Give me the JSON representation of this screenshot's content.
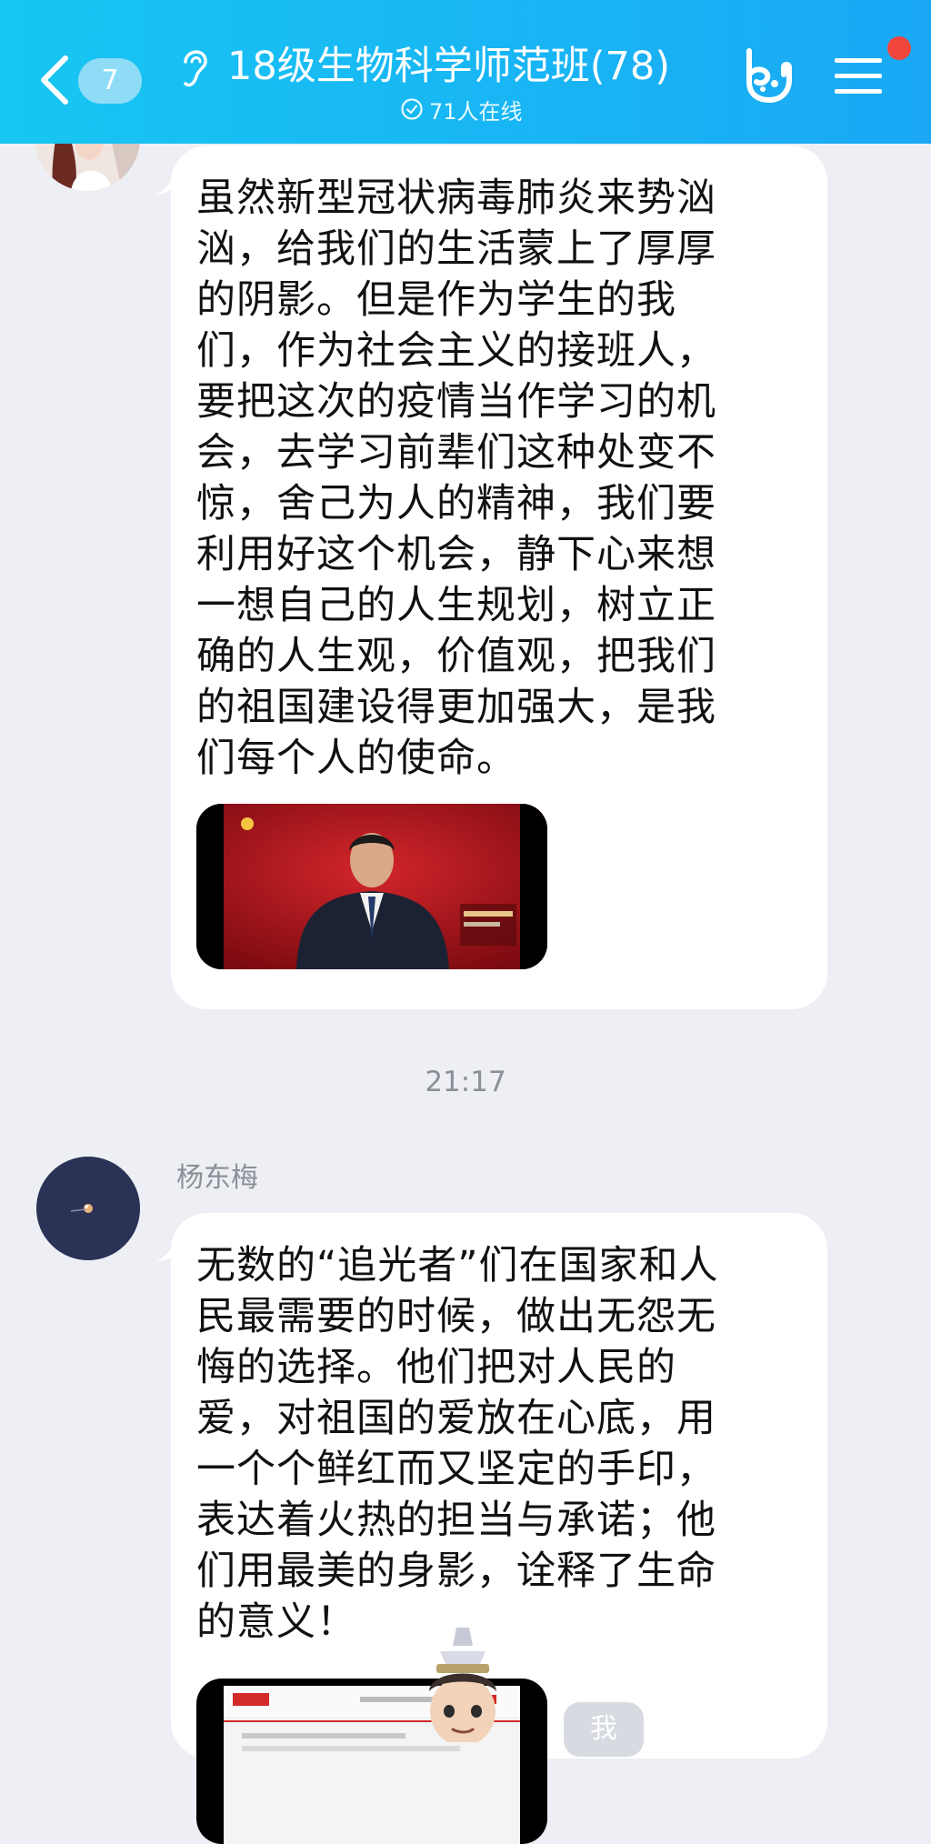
{
  "header": {
    "unread_count": "7",
    "title": "18级生物科学师范班(78)",
    "online_status": "71人在线",
    "gradient_start": "#17c6f2",
    "gradient_end": "#1aa8f5"
  },
  "messages": [
    {
      "sender": "",
      "avatar": "avatar-photo",
      "lines": [
        "虽然新型冠状病毒肺炎来势汹",
        "汹，给我们的生活蒙上了厚厚",
        "的阴影。但是作为学生的我",
        "们，作为社会主义的接班人，",
        "要把这次的疫情当作学习的机",
        "会，去学习前辈们这种处变不",
        "惊，舍己为人的精神，我们要",
        "利用好这个机会，静下心来想",
        "一想自己的人生规划，树立正",
        "确的人生观，价值观，把我们",
        "的祖国建设得更加强大，是我",
        "们每个人的使命。"
      ],
      "attachment": "video-thumbnail"
    },
    {
      "sender": "杨东梅",
      "avatar": "avatar-dark-sky",
      "lines": [
        "无数的“追光者”们在国家和人",
        "民最需要的时候，做出无怨无",
        "悔的选择。他们把对人民的",
        "爱，对祖国的爱放在心底，用",
        "一个个鲜红而又坚定的手印，",
        "表达着火热的担当与承诺；他",
        "们用最美的身影，诠释了生命",
        "的意义！"
      ],
      "attachment": "video-thumbnail"
    }
  ],
  "timestamp": "21:17",
  "me_badge": "我",
  "icons": {
    "back": "chevron-left-icon",
    "ear": "ear-icon",
    "online": "check-circle-icon",
    "gesture": "hand-gesture-icon",
    "menu": "hamburger-menu-icon",
    "notification": "red-dot-icon"
  },
  "colors": {
    "background": "#edeff4",
    "bubble": "#ffffff",
    "notification_dot": "#f0463c"
  }
}
